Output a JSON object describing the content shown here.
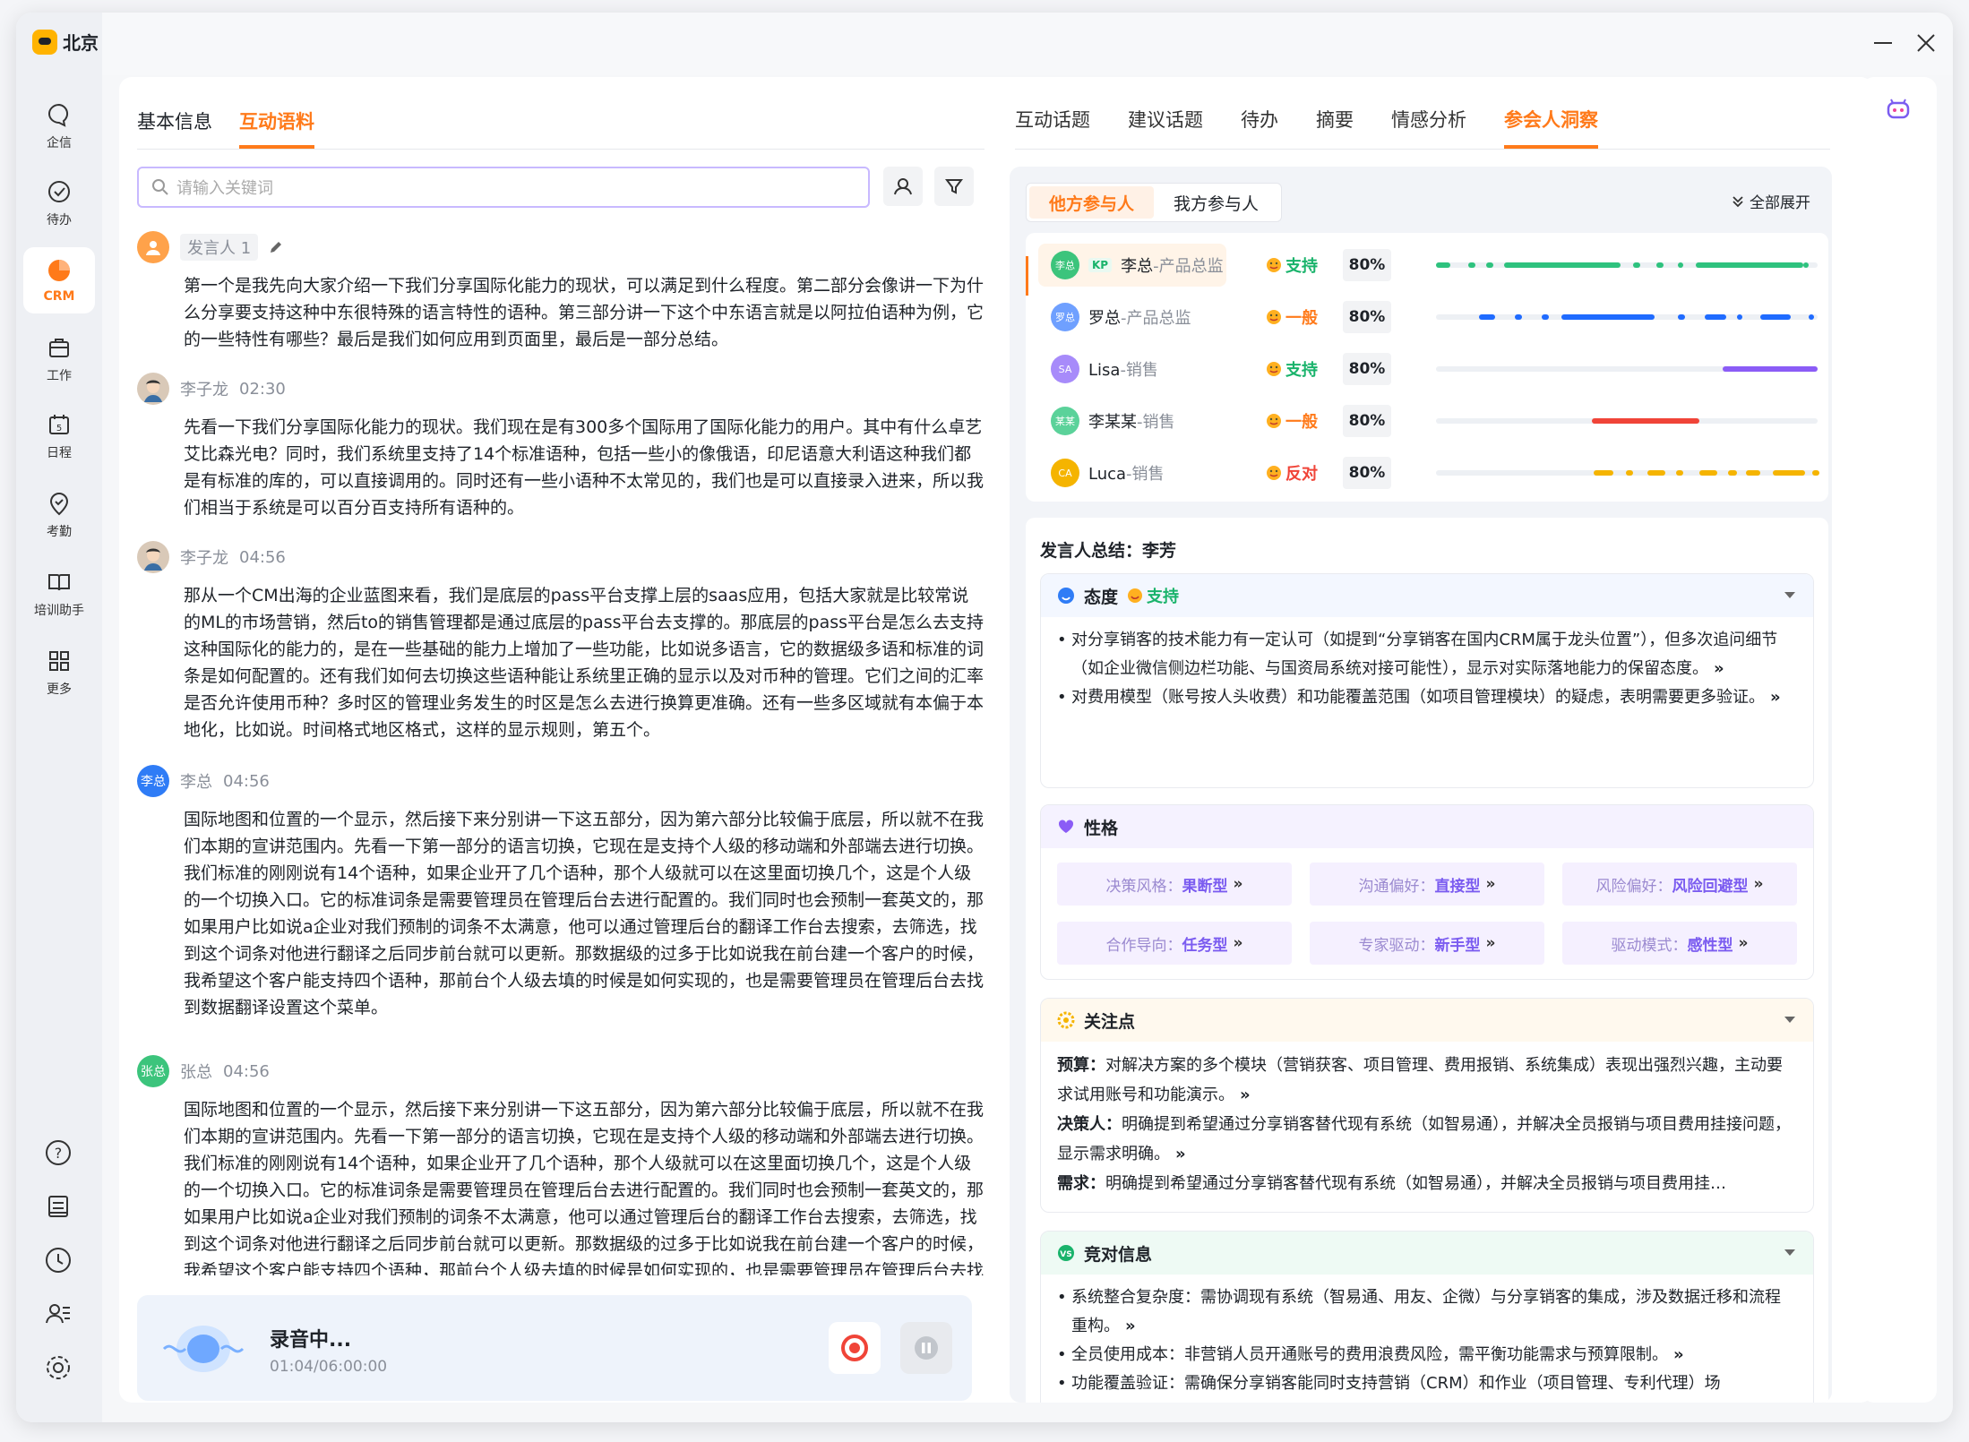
{
  "app": {
    "title": "北京"
  },
  "sidebar": {
    "items": [
      {
        "label": "企信",
        "icon": "chat-icon"
      },
      {
        "label": "待办",
        "icon": "check-circle-icon"
      },
      {
        "label": "CRM",
        "icon": "pie-chart-icon"
      },
      {
        "label": "工作",
        "icon": "briefcase-icon"
      },
      {
        "label": "日程",
        "icon": "calendar-icon"
      },
      {
        "label": "考勤",
        "icon": "location-check-icon"
      },
      {
        "label": "培训助手",
        "icon": "book-icon"
      },
      {
        "label": "更多",
        "icon": "grid-icon"
      }
    ],
    "active": "CRM"
  },
  "left": {
    "tabs": [
      "基本信息",
      "互动语料"
    ],
    "active_tab": "互动语料",
    "search_placeholder": "请输入关键词",
    "messages": [
      {
        "speaker": "发言人 1",
        "time": "",
        "avatar": "",
        "text": "第一个是我先向大家介绍一下我们分享国际化能力的现状，可以满足到什么程度。第二部分会像讲一下为什么分享要支持这种中东很特殊的语言特性的语种。第三部分讲一下这个中东语言就是以阿拉伯语种为例，它的一些特性有哪些？最后是我们如何应用到页面里，最后是一部分总结。"
      },
      {
        "speaker": "李子龙",
        "time": "02:30",
        "avatar": "",
        "text": "先看一下我们分享国际化能力的现状。我们现在是有300多个国际用了国际化能力的用户。其中有什么卓艺艾比森光电？同时，我们系统里支持了14个标准语种，包括一些小的像俄语，印尼语意大利语这种我们都是有标准的库的，可以直接调用的。同时还有一些小语种不太常见的，我们也是可以直接录入进来，所以我们相当于系统是可以百分百支持所有语种的。"
      },
      {
        "speaker": "李子龙",
        "time": "04:56",
        "avatar": "",
        "text": "那从一个CM出海的企业蓝图来看，我们是底层的pass平台支撑上层的saas应用，包括大家就是比较常说的ML的市场营销，然后to的销售管理都是通过底层的pass平台去支撑的。那底层的pass平台是怎么去支持这种国际化的能力的，是在一些基础的能力上增加了一些功能，比如说多语言，它的数据级多语和标准的词条是如何配置的。还有我们如何去切换这些语种能让系统里正确的显示以及对币种的管理。它们之间的汇率是否允许使用币种？多时区的管理业务发生的时区是怎么去进行换算更准确。还有一些多区域就有本偏于本地化，比如说。时间格式地区格式，这样的显示规则，第五个。"
      },
      {
        "speaker": "李总",
        "time": "04:56",
        "avatar": "李总",
        "text": "国际地图和位置的一个显示，然后接下来分别讲一下这五部分，因为第六部分比较偏于底层，所以就不在我们本期的宣讲范围内。先看一下第一部分的语言切换，它现在是支持个人级的移动端和外部端去进行切换。我们标准的刚刚说有14个语种，如果企业开了几个语种，那个人级就可以在这里面切换几个，这是个人级的一个切换入口。它的标准词条是需要管理员在管理后台去进行配置的。我们同时也会预制一套英文的，那如果用户比如说a企业对我们预制的词条不太满意，他可以通过管理后台的翻译工作台去搜索，去筛选，找到这个词条对他进行翻译之后同步前台就可以更新。那数据级的过多于比如说我在前台建一个客户的时候，我希望这个客户能支持四个语种，那前台个人级去填的时候是如何实现的，也是需要管理员在管理后台去找到数据翻译设置这个菜单。"
      },
      {
        "speaker": "张总",
        "time": "04:56",
        "avatar": "张总",
        "text": "国际地图和位置的一个显示，然后接下来分别讲一下这五部分，因为第六部分比较偏于底层，所以就不在我们本期的宣讲范围内。先看一下第一部分的语言切换，它现在是支持个人级的移动端和外部端去进行切换。我们标准的刚刚说有14个语种，如果企业开了几个语种，那个人级就可以在这里面切换几个，这是个人级的一个切换入口。它的标准词条是需要管理员在管理后台去进行配置的。我们同时也会预制一套英文的，那如果用户比如说a企业对我们预制的词条不太满意，他可以通过管理后台的翻译工作台去搜索，去筛选，找到这个词条对他进行翻译之后同步前台就可以更新。那数据级的过多于比如说我在前台建一个客户的时候，我希望这个客户能支持四个语种，那前台个人级去填的时候是如何实现的，也是需要管理员在管理后台去找到数据翻译设置这个菜单。"
      }
    ],
    "recording": {
      "title": "录音中...",
      "time": "01:04/06:00:00"
    }
  },
  "right": {
    "tabs": [
      "互动话题",
      "建议话题",
      "待办",
      "摘要",
      "情感分析",
      "参会人洞察"
    ],
    "active_tab": "参会人洞察",
    "participant_tabs": [
      "他方参与人",
      "我方参与人"
    ],
    "expand_all": "全部展开",
    "participants": [
      {
        "avatar": "李总",
        "badge": "KP",
        "name": "李总",
        "role": "-产品总监",
        "attitude": "支持",
        "attitude_color": "#19b36b",
        "percent": "80%",
        "color": "#2ec27e"
      },
      {
        "avatar": "罗总",
        "badge": "",
        "name": "罗总",
        "role": "-产品总监",
        "attitude": "一般",
        "attitude_color": "#ff7a1a",
        "percent": "80%",
        "color": "#1f6bff"
      },
      {
        "avatar": "SA",
        "badge": "",
        "name": "Lisa",
        "role": "-销售",
        "attitude": "支持",
        "attitude_color": "#19b36b",
        "percent": "80%",
        "color": "#8b5cf6"
      },
      {
        "avatar": "某某",
        "badge": "",
        "name": "李某某",
        "role": "-销售",
        "attitude": "一般",
        "attitude_color": "#ff7a1a",
        "percent": "80%",
        "color": "#f04438"
      },
      {
        "avatar": "CA",
        "badge": "",
        "name": "Luca",
        "role": "-销售",
        "attitude": "反对",
        "attitude_color": "#f04438",
        "percent": "80%",
        "color": "#f5b400"
      }
    ],
    "summary": {
      "title": "发言人总结：李芳",
      "attitude": {
        "label": "态度",
        "value": "支持",
        "bullets": [
          "对分享销客的技术能力有一定认可（如提到“分享销客在国内CRM属于龙头位置”），但多次追问细节（如企业微信侧边栏功能、与国资局系统对接可能性），显示对实际落地能力的保留态度。",
          "对费用模型（账号按人头收费）和功能覆盖范围（如项目管理模块）的疑虑，表明需要更多验证。"
        ]
      },
      "personality": {
        "label": "性格",
        "tags": [
          {
            "k": "决策风格：",
            "v": "果断型"
          },
          {
            "k": "沟通偏好：",
            "v": "直接型"
          },
          {
            "k": "风险偏好：",
            "v": "风险回避型"
          },
          {
            "k": "合作导向：",
            "v": "任务型"
          },
          {
            "k": "专家驱动：",
            "v": "新手型"
          },
          {
            "k": "驱动模式：",
            "v": "感性型"
          }
        ]
      },
      "focus": {
        "label": "关注点",
        "items": [
          {
            "k": "预算：",
            "v": "对解决方案的多个模块（营销获客、项目管理、费用报销、系统集成）表现出强烈兴趣，主动要求试用账号和功能演示。"
          },
          {
            "k": "决策人：",
            "v": "明确提到希望通过分享销客替代现有系统（如智易通），并解决全员报销与项目费用挂接问题，显示需求明确。"
          },
          {
            "k": "需求：",
            "v": "明确提到希望通过分享销客替代现有系统（如智易通），并解决全员报销与项目费用挂…"
          }
        ]
      },
      "competitor": {
        "label": "竞对信息",
        "bullets": [
          "系统整合复杂度：需协调现有系统（智易通、用友、企微）与分享销客的集成，涉及数据迁移和流程重构。",
          "全员使用成本：非营销人员开通账号的费用浪费风险，需平衡功能需求与预算限制。",
          "功能覆盖验证：需确保分享销客能同时支持营销（CRM）和作业（项目管理、专利代理）场"
        ]
      }
    }
  }
}
